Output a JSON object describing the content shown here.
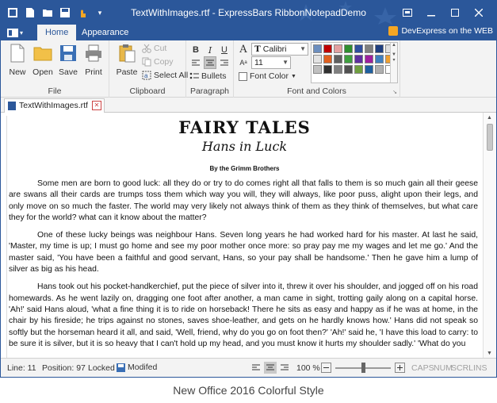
{
  "window": {
    "title": "TextWithImages.rtf - ExpressBars RibbonNotepadDemo",
    "accent": "#2b579a"
  },
  "tabs": [
    "Home",
    "Appearance"
  ],
  "devexpress_link": "DevExpress on the WEB",
  "ribbon": {
    "file": {
      "label": "File",
      "new": "New",
      "open": "Open",
      "save": "Save",
      "print": "Print"
    },
    "clipboard": {
      "label": "Clipboard",
      "paste": "Paste",
      "cut": "Cut",
      "copy": "Copy",
      "select_all": "Select All"
    },
    "paragraph": {
      "label": "Paragraph",
      "bullets": "Bullets"
    },
    "font": {
      "label": "Font and Colors",
      "font_name": "Calibri",
      "font_size": "11",
      "font_color": "Font Color"
    }
  },
  "palette": [
    [
      "#6d8fbf",
      "#c00000",
      "#e3a0a0",
      "#2f8f2f",
      "#2f4f9f",
      "#7f7f7f",
      "#1f3f7f",
      "#e0e0e0"
    ],
    [
      "#e3e3e3",
      "#e06020",
      "#5f5f5f",
      "#3f9f3f",
      "#5f2f9f",
      "#9f1f9f",
      "#3f7fbf",
      "#f0a030"
    ],
    [
      "#c0c0c0",
      "#303030",
      "#7f7f7f",
      "#505050",
      "#6f9f3f",
      "#1f5f9f",
      "#afafaf",
      "#ffffff"
    ]
  ],
  "doc_tab": {
    "name": "TextWithImages.rtf"
  },
  "document": {
    "title": "Fairy Tales",
    "subtitle": "Hans in Luck",
    "byline": "By the Grimm Brothers",
    "paragraphs": [
      "Some men are born to good luck: all they do or try to do comes right  all that falls to them is so much gain  all their geese are swans  all their cards are trumps  toss them which way you will, they will always, like poor puss, alight upon their legs, and only move on so much the faster. The world may very likely not always think of them as they think of themselves, but what care they for the world? what can it know about the matter?",
      "One of these lucky beings was neighbour Hans. Seven long years he had worked hard for his master. At last he said, 'Master, my time is up; I must go home and see my poor mother once more: so pray pay me my wages and let me go.' And the master said, 'You have been a faithful and good servant, Hans, so your pay shall be handsome.' Then he gave him a lump of silver as big as his head.",
      "Hans took out his pocket-handkerchief, put the piece of silver into it, threw it over his shoulder, and jogged off on his road homewards. As he went lazily on, dragging one foot after another, a man came in sight, trotting gaily along on a capital horse. 'Ah!' said Hans aloud, 'what a fine thing it is to ride on horseback! There he sits as easy and happy as if he was at home, in the chair by his fireside; he trips against no stones, saves shoe-leather, and gets on he hardly knows how.' Hans did not speak so softly but the horseman heard it all, and said, 'Well, friend, why do you go on foot then?' 'Ah!' said he, 'I have this load to carry: to be sure it is silver, but it is so heavy that I can't hold up my head, and you must know it hurts my shoulder sadly.' 'What do you"
    ]
  },
  "status": {
    "line": "Line: 11",
    "position": "Position: 97",
    "locked": "Locked",
    "modified": "Modifed",
    "zoom": "100 %",
    "zoom_level": 0.5,
    "caps": "CAPS",
    "num": "NUM",
    "scrl": "SCRL",
    "ins": "INS"
  },
  "caption": "New Office 2016 Colorful Style"
}
